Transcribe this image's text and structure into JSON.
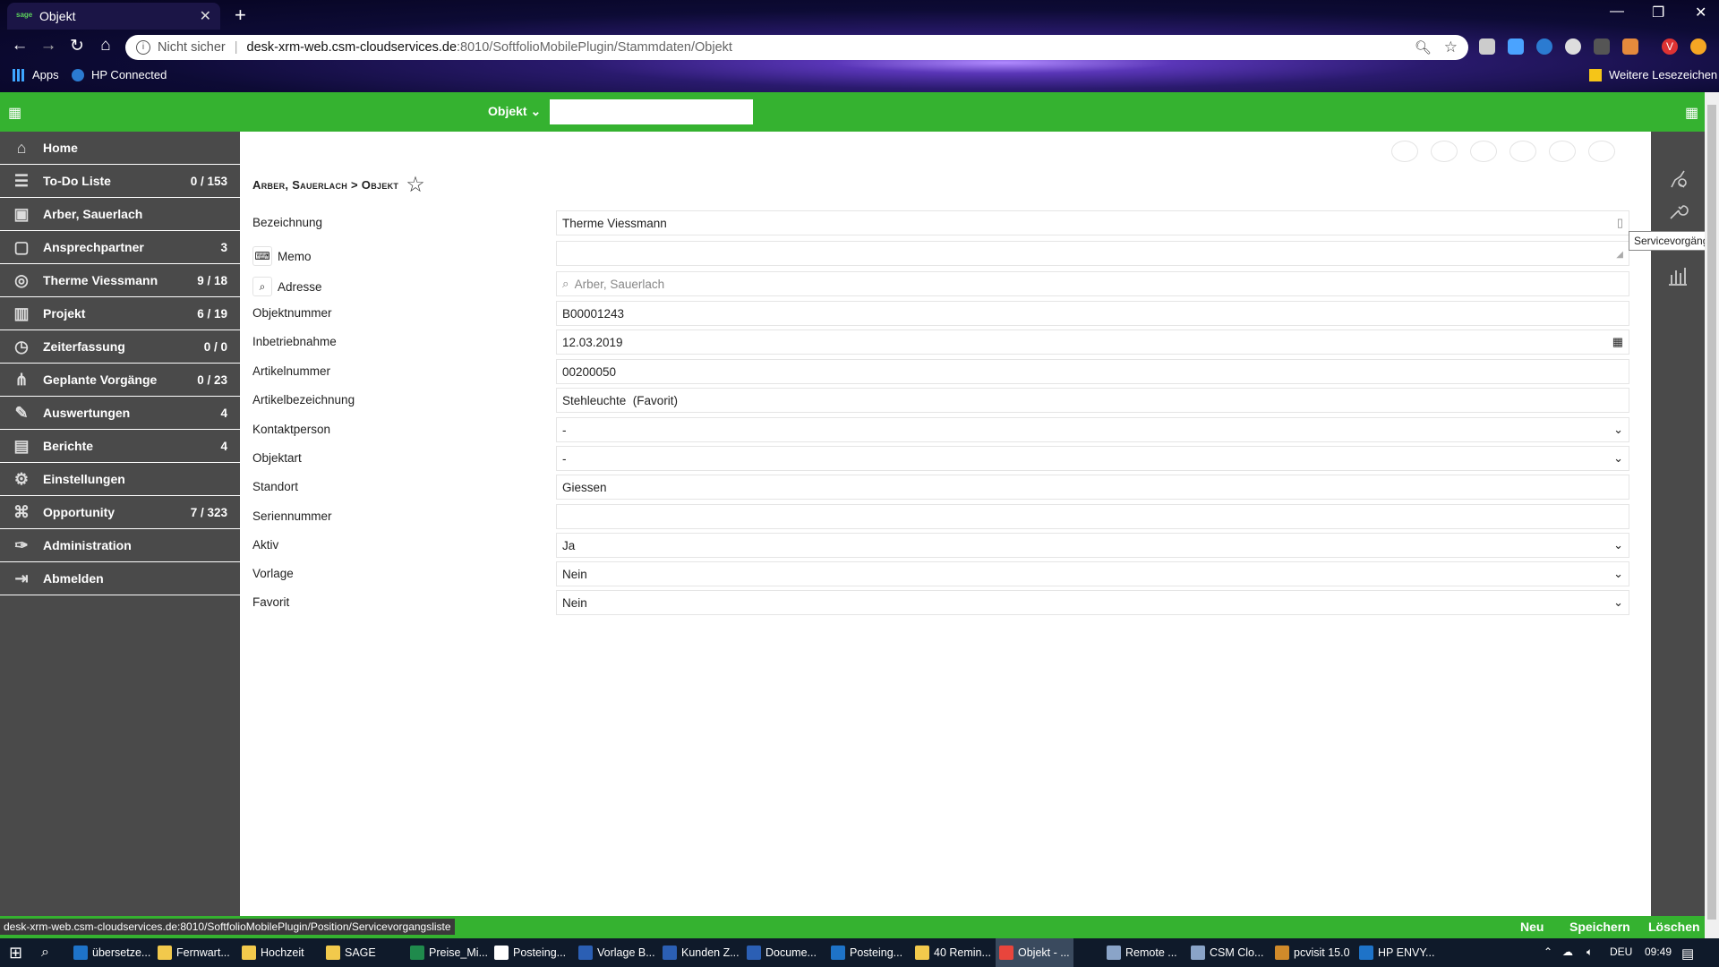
{
  "browser": {
    "tab_title": "Objekt",
    "tab_favicon": "sage",
    "security": "Nicht sicher",
    "url_host": "desk-xrm-web.csm-cloudservices.de",
    "url_path": ":8010/SoftfolioMobilePlugin/Stammdaten/Objekt",
    "bookmarks": [
      "Apps",
      "HP Connected"
    ],
    "other_bookmarks": "Weitere Lesezeichen",
    "profile_initial": "V"
  },
  "header": {
    "object_dropdown": "Objekt",
    "search_value": ""
  },
  "sidebar": {
    "items": [
      {
        "label": "Home",
        "count": "",
        "icon": "home-icon"
      },
      {
        "label": "To-Do Liste",
        "count": "0 / 153",
        "icon": "list-icon"
      },
      {
        "label": "Arber, Sauerlach",
        "count": "",
        "icon": "contact-card-icon"
      },
      {
        "label": "Ansprechpartner",
        "count": "3",
        "icon": "chat-icon"
      },
      {
        "label": "Therme Viessmann",
        "count": "9 / 18",
        "icon": "target-icon"
      },
      {
        "label": "Projekt",
        "count": "6 / 19",
        "icon": "chart-icon"
      },
      {
        "label": "Zeiterfassung",
        "count": "0 / 0",
        "icon": "clock-icon"
      },
      {
        "label": "Geplante Vorgänge",
        "count": "0 / 23",
        "icon": "share-icon"
      },
      {
        "label": "Auswertungen",
        "count": "4",
        "icon": "pen-icon"
      },
      {
        "label": "Berichte",
        "count": "4",
        "icon": "report-icon"
      },
      {
        "label": "Einstellungen",
        "count": "",
        "icon": "gear-icon"
      },
      {
        "label": "Opportunity",
        "count": "7 / 323",
        "icon": "network-icon"
      },
      {
        "label": "Administration",
        "count": "",
        "icon": "wrench-icon"
      },
      {
        "label": "Abmelden",
        "count": "",
        "icon": "logout-icon"
      }
    ]
  },
  "main": {
    "breadcrumb": "Arber, Sauerlach > Objekt",
    "fields": {
      "bezeichnung": {
        "label": "Bezeichnung",
        "value": "Therme Viessmann"
      },
      "memo": {
        "label": "Memo",
        "value": ""
      },
      "adresse": {
        "label": "Adresse",
        "placeholder": "Arber, Sauerlach"
      },
      "objektnummer": {
        "label": "Objektnummer",
        "value": "B00001243"
      },
      "inbetriebnahme": {
        "label": "Inbetriebnahme",
        "value": "12.03.2019"
      },
      "artikelnummer": {
        "label": "Artikelnummer",
        "value": "00200050"
      },
      "artikelbezeichnung": {
        "label": "Artikelbezeichnung",
        "value": "Stehleuchte  (Favorit)"
      },
      "kontaktperson": {
        "label": "Kontaktperson",
        "value": "-"
      },
      "objektart": {
        "label": "Objektart",
        "value": "-"
      },
      "standort": {
        "label": "Standort",
        "value": "Giessen"
      },
      "seriennummer": {
        "label": "Seriennummer",
        "value": ""
      },
      "aktiv": {
        "label": "Aktiv",
        "value": "Ja"
      },
      "vorlage": {
        "label": "Vorlage",
        "value": "Nein"
      },
      "favorit": {
        "label": "Favorit",
        "value": "Nein"
      }
    }
  },
  "right_toolbar": {
    "tooltip": "Servicevorgänge"
  },
  "footer": {
    "status_url": "desk-xrm-web.csm-cloudservices.de:8010/SoftfolioMobilePlugin/Position/Servicevorgangsliste",
    "buttons": [
      "Neu",
      "Speichern",
      "Löschen"
    ]
  },
  "taskbar": {
    "items": [
      {
        "label": "übersetze...",
        "color": "#1e73c8"
      },
      {
        "label": "Fernwart...",
        "color": "#f2c94c"
      },
      {
        "label": "Hochzeit",
        "color": "#f2c94c"
      },
      {
        "label": "SAGE",
        "color": "#f2c94c"
      },
      {
        "label": "Preise_Mi...",
        "color": "#1f8a4c"
      },
      {
        "label": "Posteing...",
        "color": "#ffffff"
      },
      {
        "label": "Vorlage B...",
        "color": "#2b5fb4"
      },
      {
        "label": "Kunden Z...",
        "color": "#2b5fb4"
      },
      {
        "label": "Docume...",
        "color": "#2b5fb4"
      },
      {
        "label": "Posteing...",
        "color": "#1e73c8"
      },
      {
        "label": "40 Remin...",
        "color": "#f2c94c"
      },
      {
        "label": "Objekt - ...",
        "color": "#e8453c"
      },
      {
        "label": "Remote ...",
        "color": "#8aa4c8"
      },
      {
        "label": "CSM Clo...",
        "color": "#8aa4c8"
      },
      {
        "label": "pcvisit 15.0",
        "color": "#d08a2a"
      },
      {
        "label": "HP ENVY...",
        "color": "#1e73c8"
      }
    ],
    "language": "DEU",
    "time": "09:49"
  }
}
